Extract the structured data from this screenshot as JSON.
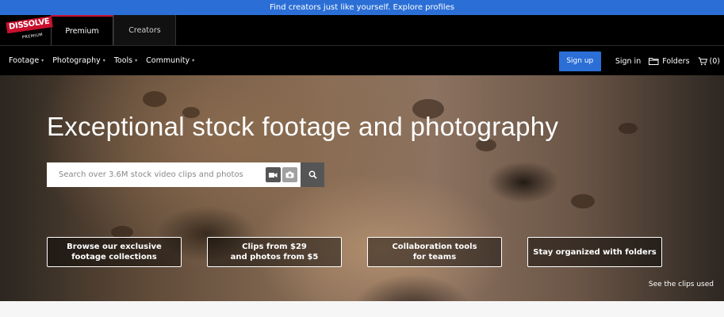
{
  "announcement": "Find creators just like yourself. Explore profiles",
  "brand": {
    "logo_main": "DISSOLVE",
    "logo_sub": "PREMIUM",
    "tabs": [
      {
        "label": "Premium"
      },
      {
        "label": "Creators"
      }
    ]
  },
  "nav": {
    "items": [
      {
        "label": "Footage"
      },
      {
        "label": "Photography"
      },
      {
        "label": "Tools"
      },
      {
        "label": "Community"
      }
    ],
    "signup": "Sign up",
    "signin": "Sign in",
    "folders": "Folders",
    "cart": "(0)"
  },
  "hero": {
    "title": "Exceptional stock footage and photography",
    "search_placeholder": "Search over 3.6M stock video clips and photos",
    "ctas": [
      {
        "line1": "Browse our exclusive",
        "line2": "footage collections"
      },
      {
        "line1": "Clips from $29",
        "line2": "and photos from $5"
      },
      {
        "line1": "Collaboration tools",
        "line2": "for teams"
      },
      {
        "line1": "Stay organized with folders",
        "line2": ""
      }
    ],
    "see_clips": "See the clips used"
  },
  "colors": {
    "accent": "#2b6fd6",
    "brand_red": "#c8102e",
    "nav_bg": "#000000"
  }
}
